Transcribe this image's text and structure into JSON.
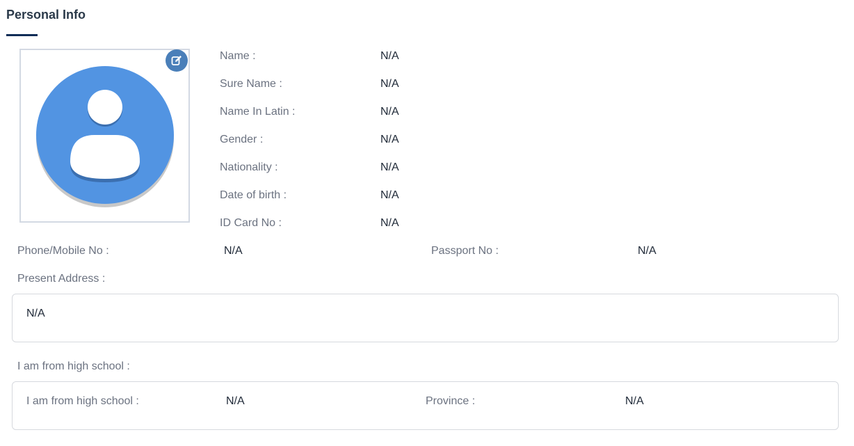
{
  "section": {
    "title": "Personal Info"
  },
  "personal": {
    "fields": [
      {
        "label": "Name :",
        "value": "N/A"
      },
      {
        "label": "Sure Name :",
        "value": "N/A"
      },
      {
        "label": "Name In Latin :",
        "value": "N/A"
      },
      {
        "label": "Gender :",
        "value": "N/A"
      },
      {
        "label": "Nationality :",
        "value": "N/A"
      },
      {
        "label": "Date of birth :",
        "value": "N/A"
      },
      {
        "label": "ID Card No :",
        "value": "N/A"
      }
    ]
  },
  "contact": {
    "phone_label": "Phone/Mobile No :",
    "phone_value": "N/A",
    "passport_label": "Passport No :",
    "passport_value": "N/A"
  },
  "address": {
    "label": "Present Address :",
    "value": "N/A"
  },
  "highschool": {
    "section_label": "I am from high school :",
    "school_label": "I am from high school :",
    "school_value": "N/A",
    "province_label": "Province :",
    "province_value": "N/A"
  },
  "colors": {
    "avatar_blue": "#5294e2",
    "edit_button": "#4a7fb9",
    "title_underline": "#0f2d57"
  },
  "icons": {
    "avatar": "default-user-avatar",
    "edit": "edit-pencil-icon"
  }
}
